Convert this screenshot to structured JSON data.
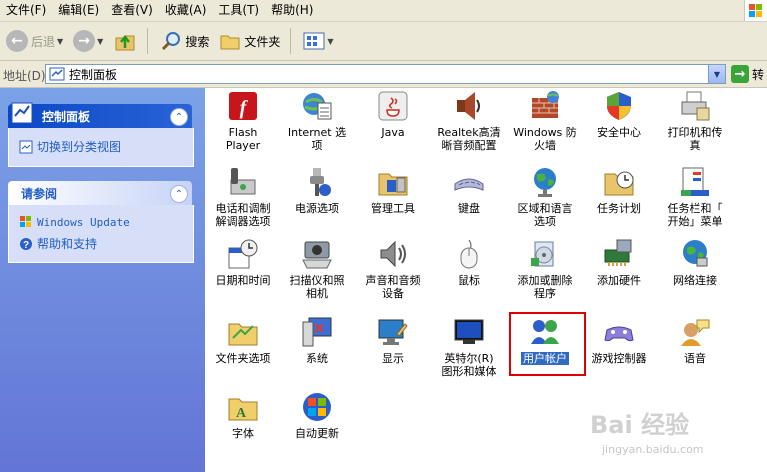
{
  "menubar": {
    "items": [
      "文件(F)",
      "编辑(E)",
      "查看(V)",
      "收藏(A)",
      "工具(T)",
      "帮助(H)"
    ]
  },
  "toolbar": {
    "back": "后退",
    "search": "搜索",
    "folders": "文件夹"
  },
  "address": {
    "label": "地址(D)",
    "value": "控制面板",
    "go": "转"
  },
  "left_panel": {
    "section1": {
      "title": "控制面板",
      "link": "切换到分类视图"
    },
    "section2": {
      "title": "请参阅",
      "links": [
        "Windows Update",
        "帮助和支持"
      ]
    }
  },
  "items": [
    {
      "label": "Flash\nPlayer",
      "icon": "flash-icon"
    },
    {
      "label": "Internet 选\n项",
      "icon": "internet-options-icon"
    },
    {
      "label": "Java",
      "icon": "java-icon"
    },
    {
      "label": "Realtek高清\n晰音频配置",
      "icon": "realtek-audio-icon"
    },
    {
      "label": "Windows 防\n火墙",
      "icon": "firewall-icon"
    },
    {
      "label": "安全中心",
      "icon": "security-center-icon"
    },
    {
      "label": "打印机和传\n真",
      "icon": "printers-icon"
    },
    {
      "label": "电话和调制\n解调器选项",
      "icon": "phone-modem-icon"
    },
    {
      "label": "电源选项",
      "icon": "power-options-icon"
    },
    {
      "label": "管理工具",
      "icon": "admin-tools-icon"
    },
    {
      "label": "键盘",
      "icon": "keyboard-icon"
    },
    {
      "label": "区域和语言\n选项",
      "icon": "globe-icon"
    },
    {
      "label": "任务计划",
      "icon": "scheduled-tasks-icon"
    },
    {
      "label": "任务栏和「\n开始」菜单",
      "icon": "taskbar-icon"
    },
    {
      "label": "日期和时间",
      "icon": "date-time-icon"
    },
    {
      "label": "扫描仪和照\n相机",
      "icon": "scanner-camera-icon"
    },
    {
      "label": "声音和音频\n设备",
      "icon": "sound-icon"
    },
    {
      "label": "鼠标",
      "icon": "mouse-icon"
    },
    {
      "label": "添加或删除\n程序",
      "icon": "add-remove-programs-icon"
    },
    {
      "label": "添加硬件",
      "icon": "add-hardware-icon"
    },
    {
      "label": "网络连接",
      "icon": "network-icon"
    },
    {
      "label": "文件夹选项",
      "icon": "folder-options-icon"
    },
    {
      "label": "系统",
      "icon": "system-icon"
    },
    {
      "label": "显示",
      "icon": "display-icon"
    },
    {
      "label": "英特尔(R)\n图形和媒体",
      "icon": "intel-graphics-icon"
    },
    {
      "label": "用户帐户",
      "icon": "user-accounts-icon"
    },
    {
      "label": "游戏控制器",
      "icon": "game-controller-icon"
    },
    {
      "label": "语音",
      "icon": "speech-icon"
    },
    {
      "label": "字体",
      "icon": "fonts-icon"
    },
    {
      "label": "自动更新",
      "icon": "automatic-updates-icon"
    }
  ],
  "watermark": {
    "text": "Bai 经验",
    "url": "jingyan.baidu.com"
  }
}
